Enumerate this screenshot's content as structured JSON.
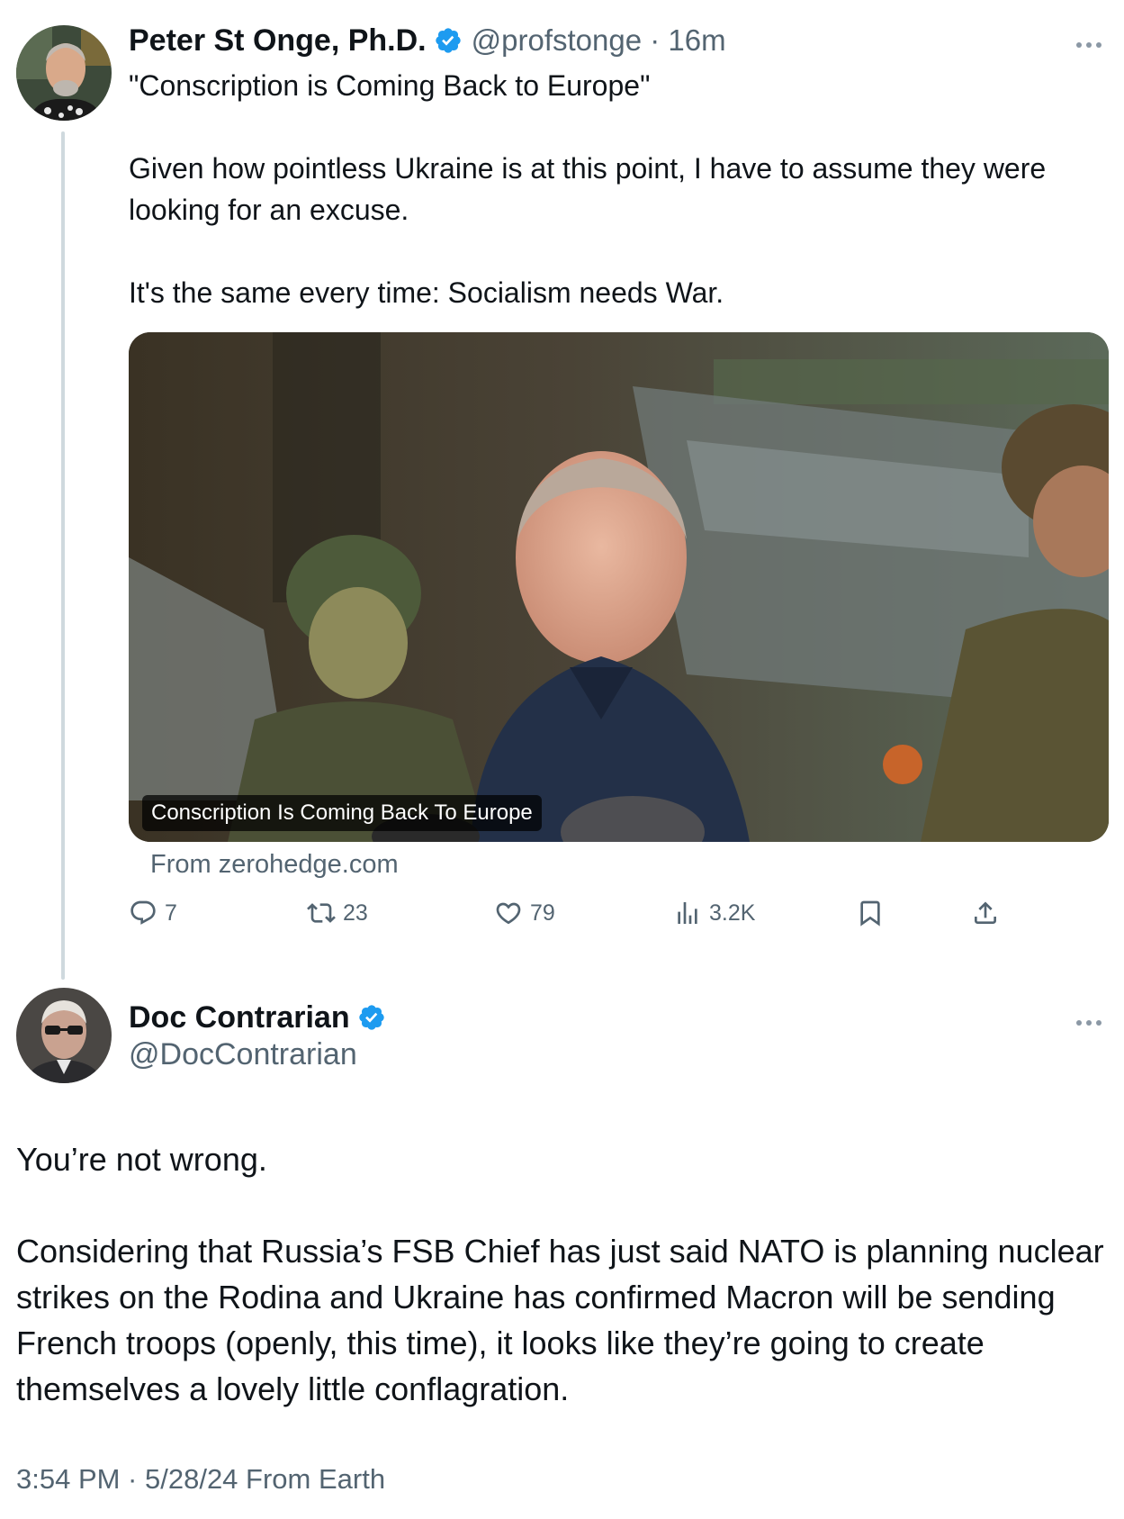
{
  "colors": {
    "text_primary": "#0f1419",
    "text_secondary": "#536471",
    "verified_blue": "#1d9bf0",
    "thread_line": "#cfd9de"
  },
  "tweet1": {
    "display_name": "Peter St Onge, Ph.D.",
    "verified": true,
    "handle_meta": "@profstonge · 16m",
    "text_paragraphs": [
      "\"Conscription is Coming Back to Europe\"",
      "Given how pointless Ukraine is at this point, I have to assume they were looking for an excuse.",
      "It's the same every time: Socialism needs War."
    ],
    "card": {
      "caption": "Conscription Is Coming Back To Europe",
      "source": "From zerohedge.com"
    },
    "actions": {
      "replies": "7",
      "retweets": "23",
      "likes": "79",
      "views": "3.2K"
    },
    "icons": [
      "more-icon",
      "verified-badge-icon",
      "reply-icon",
      "retweet-icon",
      "like-icon",
      "views-icon",
      "bookmark-icon",
      "share-icon"
    ]
  },
  "tweet2": {
    "display_name": "Doc Contrarian",
    "verified": true,
    "handle": "@DocContrarian",
    "text_paragraphs": [
      "You’re not wrong.",
      "Considering that Russia’s FSB Chief has just said NATO is planning nuclear strikes on the Rodina and Ukraine has confirmed Macron will be sending French troops (openly, this time), it looks like they’re going to create themselves a lovely little conflagration."
    ],
    "meta": "3:54 PM · 5/28/24 From Earth"
  }
}
